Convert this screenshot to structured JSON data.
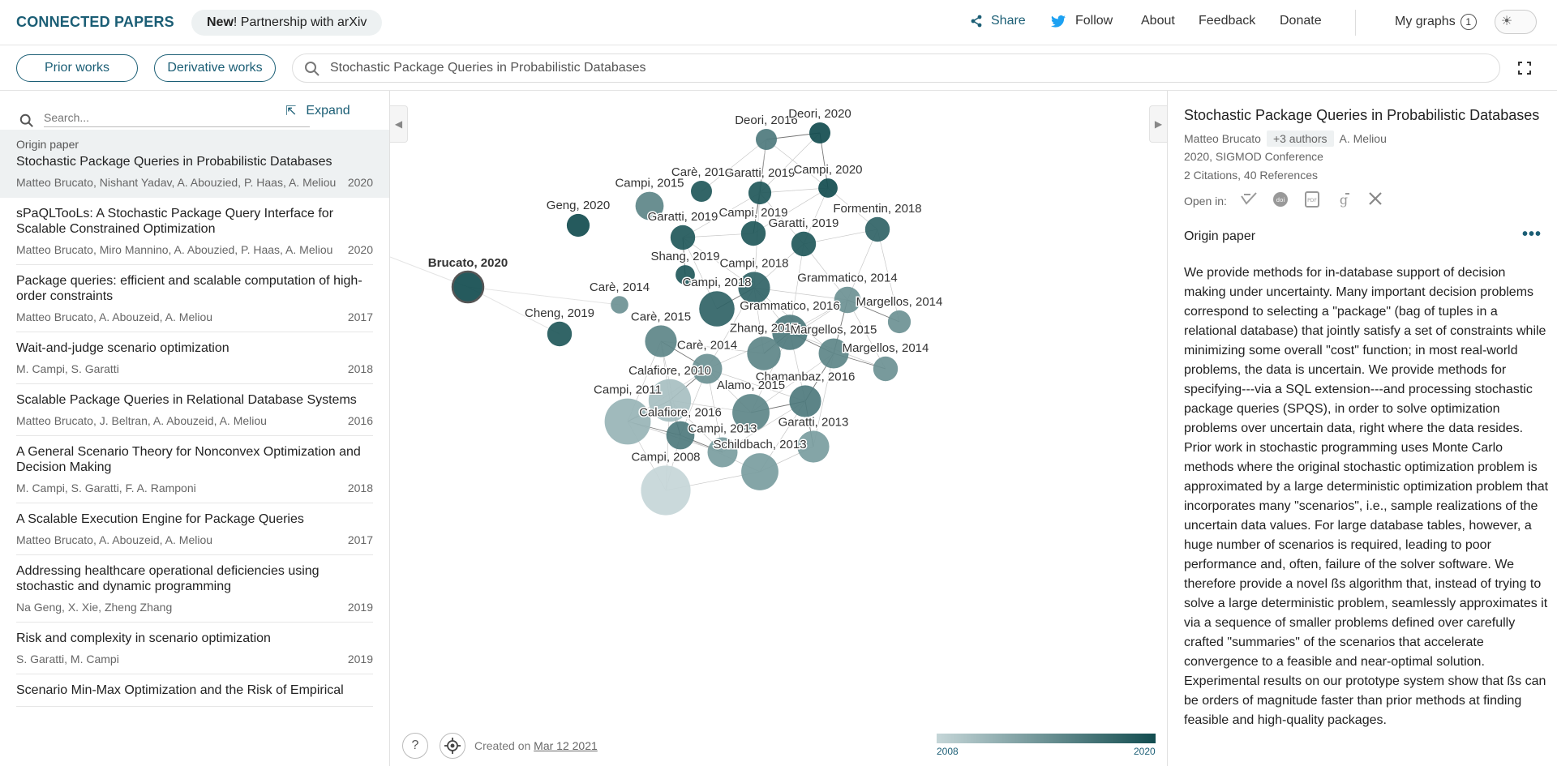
{
  "header": {
    "brand": "CONNECTED PAPERS",
    "news_bold": "New",
    "news_rest": "! Partnership with arXiv",
    "share": "Share",
    "follow": "Follow",
    "about": "About",
    "feedback": "Feedback",
    "donate": "Donate",
    "my_graphs": "My graphs",
    "my_graphs_count": "1"
  },
  "toolbar": {
    "prior_works": "Prior works",
    "derivative_works": "Derivative works",
    "search_value": "Stochastic Package Queries in Probabilistic Databases"
  },
  "list": {
    "search_placeholder": "Search...",
    "expand_label": "Expand",
    "origin_tag": "Origin paper",
    "items": [
      {
        "title": "Stochastic Package Queries in Probabilistic Databases",
        "authors": "Matteo Brucato, Nishant Yadav, A. Abouzied, P. Haas, A. Meliou",
        "year": "2020"
      },
      {
        "title": "sPaQLTooLs: A Stochastic Package Query Interface for Scalable Constrained Optimization",
        "authors": "Matteo Brucato, Miro Mannino, A. Abouzied, P. Haas, A. Meliou",
        "year": "2020"
      },
      {
        "title": "Package queries: efficient and scalable computation of high-order constraints",
        "authors": "Matteo Brucato, A. Abouzeid, A. Meliou",
        "year": "2017"
      },
      {
        "title": "Wait-and-judge scenario optimization",
        "authors": "M. Campi, S. Garatti",
        "year": "2018"
      },
      {
        "title": "Scalable Package Queries in Relational Database Systems",
        "authors": "Matteo Brucato, J. Beltran, A. Abouzeid, A. Meliou",
        "year": "2016"
      },
      {
        "title": "A General Scenario Theory for Nonconvex Optimization and Decision Making",
        "authors": "M. Campi, S. Garatti, F. A. Ramponi",
        "year": "2018"
      },
      {
        "title": "A Scalable Execution Engine for Package Queries",
        "authors": "Matteo Brucato, A. Abouzeid, A. Meliou",
        "year": "2017"
      },
      {
        "title": "Addressing healthcare operational deficiencies using stochastic and dynamic programming",
        "authors": "Na Geng, X. Xie, Zheng Zhang",
        "year": "2019"
      },
      {
        "title": "Risk and complexity in scenario optimization",
        "authors": "S. Garatti, M. Campi",
        "year": "2019"
      },
      {
        "title": "Scenario Min-Max Optimization and the Risk of Empirical",
        "authors": "",
        "year": ""
      }
    ]
  },
  "graph": {
    "created_prefix": "Created on ",
    "created_date": "Mar 12 2021",
    "legend_min": "2008",
    "legend_max": "2020",
    "color_old": "#c5d6d8",
    "color_new": "#124c4f",
    "nodes": [
      {
        "label": "Brucato, 2020",
        "year": 2020,
        "size": 1,
        "origin": true
      },
      {
        "label": "Deori, 2016",
        "year": 2016,
        "size": 1
      },
      {
        "label": "Deori, 2020",
        "year": 2020,
        "size": 1
      },
      {
        "label": "Carè, 2019",
        "year": 2019,
        "size": 1
      },
      {
        "label": "Garatti, 2019",
        "year": 2019,
        "size": 1.1
      },
      {
        "label": "Campi, 2020",
        "year": 2020,
        "size": 0.9
      },
      {
        "label": "Campi, 2015",
        "year": 2015,
        "size": 1.4
      },
      {
        "label": "Geng, 2020",
        "year": 2020,
        "size": 1.1
      },
      {
        "label": "Garatti, 2019",
        "year": 2019,
        "size": 1.2
      },
      {
        "label": "Campi, 2019",
        "year": 2019,
        "size": 1.2
      },
      {
        "label": "Garatti, 2019",
        "year": 2019,
        "size": 1.2
      },
      {
        "label": "Formentin, 2018",
        "year": 2018,
        "size": 1.2
      },
      {
        "label": "Shang, 2019",
        "year": 2019,
        "size": 0.9
      },
      {
        "label": "Campi, 2018",
        "year": 2018,
        "size": 1.6
      },
      {
        "label": "Carè, 2014",
        "year": 2014,
        "size": 0.8
      },
      {
        "label": "Campi, 2018",
        "year": 2018,
        "size": 1.8
      },
      {
        "label": "Grammatico, 2014",
        "year": 2014,
        "size": 1.3
      },
      {
        "label": "Cheng, 2019",
        "year": 2019,
        "size": 1.2
      },
      {
        "label": "Margellos, 2014",
        "year": 2014,
        "size": 1.1
      },
      {
        "label": "Carè, 2015",
        "year": 2015,
        "size": 1.6
      },
      {
        "label": "Grammatico, 2016",
        "year": 2016,
        "size": 1.8
      },
      {
        "label": "Zhang, 2015",
        "year": 2015,
        "size": 1.7
      },
      {
        "label": "Margellos, 2015",
        "year": 2015,
        "size": 1.5
      },
      {
        "label": "Carè, 2014",
        "year": 2014,
        "size": 1.5
      },
      {
        "label": "Margellos, 2014",
        "year": 2014,
        "size": 1.2
      },
      {
        "label": "Calafiore, 2010",
        "year": 2010,
        "size": 2.2
      },
      {
        "label": "Chamanbaz, 2016",
        "year": 2016,
        "size": 1.6
      },
      {
        "label": "Alamo, 2015",
        "year": 2015,
        "size": 1.9
      },
      {
        "label": "Campi, 2011",
        "year": 2011,
        "size": 2.4
      },
      {
        "label": "Calafiore, 2016",
        "year": 2016,
        "size": 1.4
      },
      {
        "label": "Campi, 2013",
        "year": 2013,
        "size": 1.5
      },
      {
        "label": "Garatti, 2013",
        "year": 2013,
        "size": 1.6
      },
      {
        "label": "Schildbach, 2013",
        "year": 2013,
        "size": 1.9
      },
      {
        "label": "Campi, 2008",
        "year": 2008,
        "size": 2.6
      }
    ]
  },
  "details": {
    "title": "Stochastic Package Queries in Probabilistic Databases",
    "first_author": "Matteo Brucato",
    "more_authors": "+3 authors",
    "last_author": "A. Meliou",
    "venue": "2020, SIGMOD Conference",
    "citations": "2 Citations, 40 References",
    "open_in_label": "Open in:",
    "origin_label": "Origin paper",
    "abstract": "We provide methods for in-database support of decision making under uncertainty. Many important decision problems correspond to selecting a \"package\" (bag of tuples in a relational database) that jointly satisfy a set of constraints while minimizing some overall \"cost\" function; in most real-world problems, the data is uncertain. We provide methods for specifying---via a SQL extension---and processing stochastic package queries (SPQS), in order to solve optimization problems over uncertain data, right where the data resides. Prior work in stochastic programming uses Monte Carlo methods where the original stochastic optimization problem is approximated by a large deterministic optimization problem that incorporates many \"scenarios\", i.e., sample realizations of the uncertain data values. For large database tables, however, a huge number of scenarios is required, leading to poor performance and, often, failure of the solver software. We therefore provide a novel ßs algorithm that, instead of trying to solve a large deterministic problem, seamlessly approximates it via a sequence of smaller problems defined over carefully crafted \"summaries\" of the scenarios that accelerate convergence to a feasible and near-optimal solution. Experimental results on our prototype system show that ßs can be orders of magnitude faster than prior methods at finding feasible and high-quality packages."
  }
}
